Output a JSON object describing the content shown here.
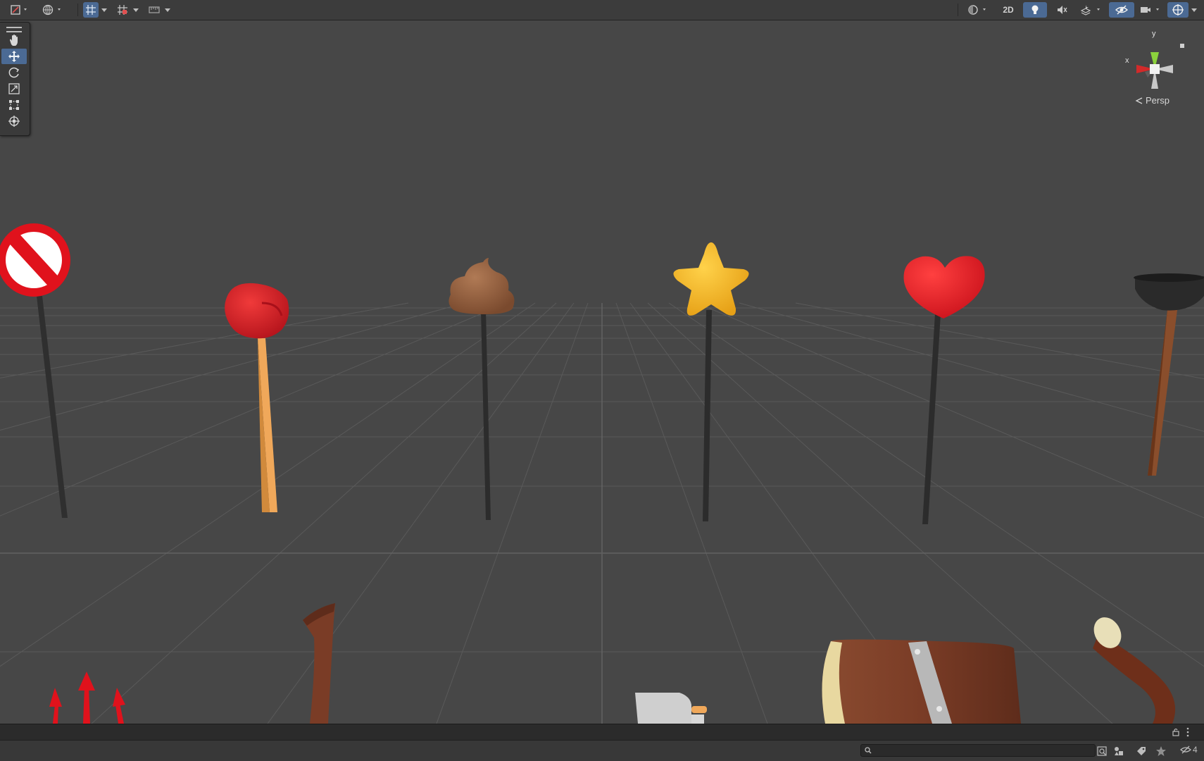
{
  "toolbar": {
    "mode_2d_label": "2D",
    "icons": [
      "draw-mode-icon",
      "globe-icon",
      "snap-grid-icon",
      "increment-snap-icon",
      "ruler-icon",
      "shading-icon",
      "lighting-icon",
      "audio-icon",
      "effects-icon",
      "hidden-objects-icon",
      "camera-icon",
      "gizmos-icon"
    ]
  },
  "tools": [
    "hand-tool",
    "move-tool",
    "rotate-tool",
    "scale-tool",
    "rect-tool",
    "transform-tool"
  ],
  "gizmo": {
    "y_label": "y",
    "x_label": "x",
    "projection_label": "Persp"
  },
  "scene_objects": [
    "no-sign-prop",
    "boxing-glove-prop",
    "poop-prop",
    "star-prop",
    "heart-prop",
    "plunger-prop",
    "trident-prop",
    "horn-prop",
    "cleaver-prop",
    "barrel-prop",
    "branch-prop"
  ],
  "bottombar": {
    "search_placeholder": "",
    "hidden_count": "4"
  },
  "colors": {
    "viewport_bg": "#474747",
    "toolbar_bg": "#3c3c3c",
    "active_blue": "#4b6a94"
  }
}
